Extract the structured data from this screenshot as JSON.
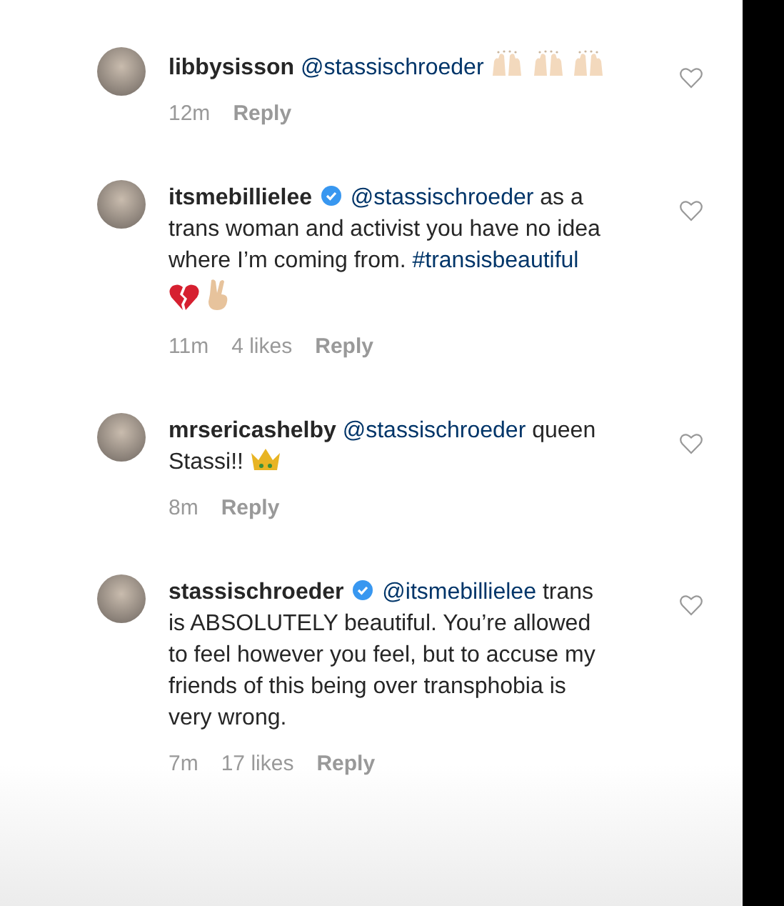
{
  "comments": [
    {
      "username": "libbysisson",
      "verified": false,
      "liked": false,
      "body": [
        {
          "kind": "mention",
          "text": "@stassischroeder"
        },
        {
          "kind": "emoji-hands"
        },
        {
          "kind": "emoji-hands"
        },
        {
          "kind": "emoji-hands"
        }
      ],
      "time": "12m",
      "reply": "Reply"
    },
    {
      "username": "itsmebillielee",
      "verified": true,
      "liked": false,
      "body": [
        {
          "kind": "mention",
          "text": "@stassischroeder"
        },
        {
          "kind": "text",
          "text": "as a trans woman and activist you have no idea where I’m coming from."
        },
        {
          "kind": "mention",
          "text": "#transisbeautiful"
        },
        {
          "kind": "emoji-broken-heart"
        },
        {
          "kind": "emoji-victory"
        }
      ],
      "time": "11m",
      "likes": "4 likes",
      "reply": "Reply"
    },
    {
      "username": "mrsericashelby",
      "verified": false,
      "liked": false,
      "body": [
        {
          "kind": "mention",
          "text": "@stassischroeder"
        },
        {
          "kind": "text",
          "text": "queen Stassi!!"
        },
        {
          "kind": "emoji-crown"
        }
      ],
      "time": "8m",
      "reply": "Reply"
    },
    {
      "username": "stassischroeder",
      "verified": true,
      "liked": false,
      "body": [
        {
          "kind": "mention",
          "text": "@itsmebillielee"
        },
        {
          "kind": "text",
          "text": "trans is ABSOLUTELY beautiful. You’re allowed to feel however you feel, but to accuse my friends of this being over transphobia is very wrong."
        }
      ],
      "time": "7m",
      "likes": "17 likes",
      "reply": "Reply"
    }
  ]
}
